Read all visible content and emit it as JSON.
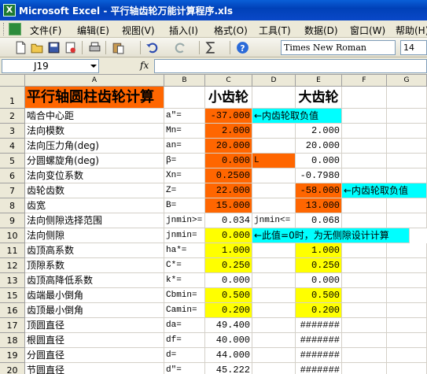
{
  "window": {
    "title": "Microsoft Excel - 平行轴齿轮万能计算程序.xls"
  },
  "menu": [
    {
      "label": "文件(F)"
    },
    {
      "label": "编辑(E)"
    },
    {
      "label": "视图(V)"
    },
    {
      "label": "插入(I)"
    },
    {
      "label": "格式(O)"
    },
    {
      "label": "工具(T)"
    },
    {
      "label": "数据(D)"
    },
    {
      "label": "窗口(W)"
    },
    {
      "label": "帮助(H)"
    }
  ],
  "toolbar": {
    "icons": [
      "new-icon",
      "open-icon",
      "save-icon",
      "permission-icon",
      "print-icon",
      "paste-icon",
      "undo-icon",
      "redo-icon",
      "autosum-icon",
      "help-icon"
    ],
    "font_name": "Times New Roman",
    "font_size": "14"
  },
  "formula_bar": {
    "name_box": "J19",
    "fx_label": "fx",
    "formula": ""
  },
  "columns": [
    "A",
    "B",
    "C",
    "D",
    "E",
    "F",
    "G"
  ],
  "colors": {
    "orange": "#ff6600",
    "yellow": "#ffff00",
    "cyan": "#00ffff"
  },
  "sheet": {
    "title": "平行轴圆柱齿轮计算",
    "small_gear": "小齿轮",
    "large_gear": "大齿轮",
    "rows": [
      {
        "n": "2",
        "a": "啮合中心距",
        "b": "a\"=",
        "c": "-37.000",
        "d": "",
        "e": "",
        "note": "←内齿轮取负值"
      },
      {
        "n": "3",
        "a": "法向模数",
        "b": "Mn=",
        "c": "2.000",
        "d": "",
        "e": "2.000",
        "note": ""
      },
      {
        "n": "4",
        "a": "法向压力角(deg)",
        "b": "an=",
        "c": "20.000",
        "d": "",
        "e": "20.000",
        "note": ""
      },
      {
        "n": "5",
        "a": "分圆螺旋角(deg)",
        "b": "β=",
        "c": "0.000",
        "d": "L",
        "e": "0.000",
        "note": ""
      },
      {
        "n": "6",
        "a": "法向变位系数",
        "b": "Xn=",
        "c": "0.2500",
        "d": "",
        "e": "-0.7980",
        "note": ""
      },
      {
        "n": "7",
        "a": "齿轮齿数",
        "b": "Z=",
        "c": "22.000",
        "d": "",
        "e": "-58.000",
        "note": "←内齿轮取负值"
      },
      {
        "n": "8",
        "a": "齿宽",
        "b": "B=",
        "c": "15.000",
        "d": "",
        "e": "13.000",
        "note": ""
      },
      {
        "n": "9",
        "a": "法向侧隙选择范围",
        "b": "jnmin>=",
        "c": "0.034",
        "d": "jnmin<=",
        "e": "0.068",
        "note": ""
      },
      {
        "n": "10",
        "a": "法向侧隙",
        "b": "jnmin=",
        "c": "0.000",
        "d": "",
        "e": "",
        "note": "←此值=0时，为无侧隙设计计算"
      },
      {
        "n": "11",
        "a": "齿顶高系数",
        "b": "ha*=",
        "c": "1.000",
        "d": "",
        "e": "1.000",
        "note": ""
      },
      {
        "n": "12",
        "a": "顶隙系数",
        "b": "C*=",
        "c": "0.250",
        "d": "",
        "e": "0.250",
        "note": ""
      },
      {
        "n": "13",
        "a": "齿顶高降低系数",
        "b": "k*=",
        "c": "0.000",
        "d": "",
        "e": "0.000",
        "note": ""
      },
      {
        "n": "15",
        "a": "齿端最小倒角",
        "b": "Cbmin=",
        "c": "0.500",
        "d": "",
        "e": "0.500",
        "note": ""
      },
      {
        "n": "16",
        "a": "齿顶最小倒角",
        "b": "Camin=",
        "c": "0.200",
        "d": "",
        "e": "0.200",
        "note": ""
      },
      {
        "n": "17",
        "a": "顶圆直径",
        "b": "da=",
        "c": "49.400",
        "d": "",
        "e": "#######",
        "note": ""
      },
      {
        "n": "18",
        "a": "根圆直径",
        "b": "df=",
        "c": "40.000",
        "d": "",
        "e": "#######",
        "note": ""
      },
      {
        "n": "19",
        "a": "分圆直径",
        "b": "d=",
        "c": "44.000",
        "d": "",
        "e": "#######",
        "note": ""
      },
      {
        "n": "20",
        "a": "节圆直径",
        "b": "d\"=",
        "c": "45.222",
        "d": "",
        "e": "#######",
        "note": ""
      }
    ]
  }
}
